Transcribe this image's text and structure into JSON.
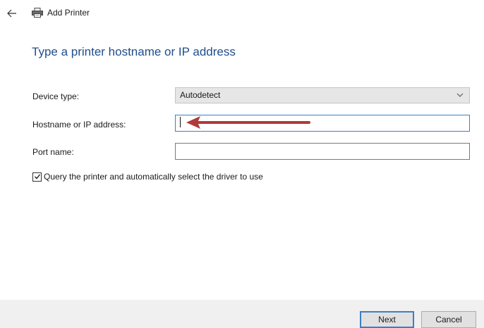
{
  "window": {
    "title": "Add Printer",
    "back_icon": "back-arrow-icon",
    "app_icon": "printer-icon"
  },
  "page": {
    "heading": "Type a printer hostname or IP address"
  },
  "form": {
    "device_type": {
      "label": "Device type:",
      "value": "Autodetect"
    },
    "hostname": {
      "label": "Hostname or IP address:",
      "value": ""
    },
    "port_name": {
      "label": "Port name:",
      "value": ""
    },
    "query_driver": {
      "label": "Query the printer and automatically select the driver to use",
      "checked": true
    }
  },
  "footer": {
    "next_label": "Next",
    "cancel_label": "Cancel"
  },
  "colors": {
    "heading": "#1f4e8c",
    "focus_border": "#3c7fc4",
    "annotation_arrow": "#b03a3a",
    "footer_bg": "#f0f0f0"
  }
}
